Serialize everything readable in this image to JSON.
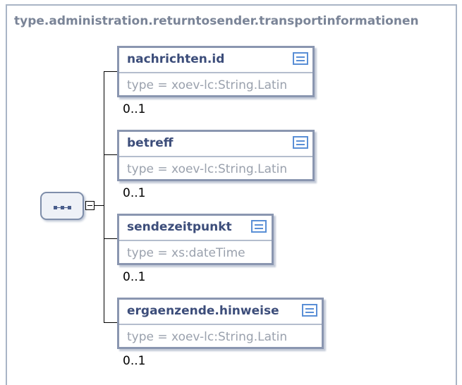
{
  "diagram": {
    "title": "type.administration.returntosender.transportinformationen",
    "elements": [
      {
        "name": "nachrichten.id",
        "type": "type = xoev-lc:String.Latin",
        "cardinality": "0..1"
      },
      {
        "name": "betreff",
        "type": "type = xoev-lc:String.Latin",
        "cardinality": "0..1"
      },
      {
        "name": "sendezeitpunkt",
        "type": "type = xs:dateTime",
        "cardinality": "0..1"
      },
      {
        "name": "ergaenzende.hinweise",
        "type": "type = xoev-lc:String.Latin",
        "cardinality": "0..1"
      }
    ]
  },
  "icons": {
    "sequence": "sequence-compositor-icon",
    "collapse": "collapse-minus-icon",
    "documentation": "documentation-icon"
  }
}
